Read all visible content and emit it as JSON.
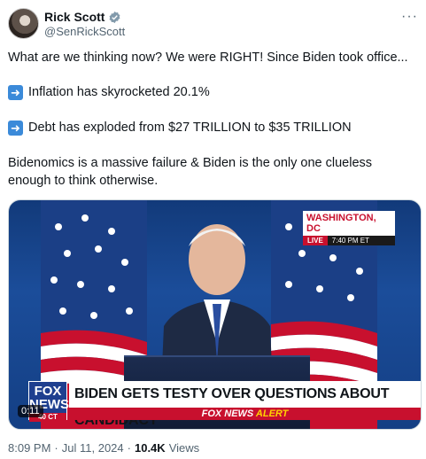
{
  "author": {
    "name": "Rick Scott",
    "handle": "@SenRickScott",
    "verified_color": "#829aab"
  },
  "tweet": {
    "line1": "What are we thinking now? We were RIGHT! Since Biden took office...",
    "line2": "Inflation has skyrocketed 20.1%",
    "line3": "Debt has exploded from $27 TRILLION to $35 TRILLION",
    "line4": "Bidenomics is a massive failure & Biden is the only one clueless enough to think otherwise.",
    "bullet_icon": "right-arrow-emoji"
  },
  "media": {
    "location": "WASHINGTON, DC",
    "live": "LIVE",
    "time": "7:40 PM ET",
    "network_logo_top": "FOX",
    "network_logo_bottom": "NEWS",
    "network_ct": "40 CT",
    "headline": "BIDEN GETS TESTY OVER QUESTIONS ABOUT CANDIDACY",
    "alert_prefix": "FOX NEWS",
    "alert_suffix": "ALERT",
    "duration": "0:11"
  },
  "meta": {
    "time": "8:09 PM",
    "sep1": "·",
    "date": "Jul 11, 2024",
    "sep2": "·",
    "views_count": "10.4K",
    "views_label": "Views"
  },
  "more_icon": "···"
}
